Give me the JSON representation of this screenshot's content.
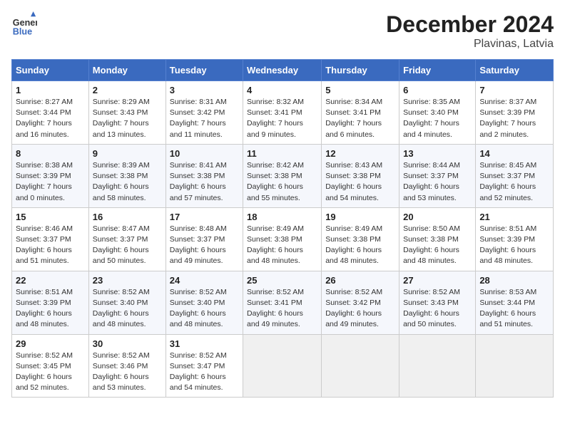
{
  "header": {
    "logo_line1": "General",
    "logo_line2": "Blue",
    "title": "December 2024",
    "subtitle": "Plavinas, Latvia"
  },
  "columns": [
    "Sunday",
    "Monday",
    "Tuesday",
    "Wednesday",
    "Thursday",
    "Friday",
    "Saturday"
  ],
  "weeks": [
    [
      {
        "day": "1",
        "sunrise": "8:27 AM",
        "sunset": "3:44 PM",
        "daylight": "7 hours and 16 minutes."
      },
      {
        "day": "2",
        "sunrise": "8:29 AM",
        "sunset": "3:43 PM",
        "daylight": "7 hours and 13 minutes."
      },
      {
        "day": "3",
        "sunrise": "8:31 AM",
        "sunset": "3:42 PM",
        "daylight": "7 hours and 11 minutes."
      },
      {
        "day": "4",
        "sunrise": "8:32 AM",
        "sunset": "3:41 PM",
        "daylight": "7 hours and 9 minutes."
      },
      {
        "day": "5",
        "sunrise": "8:34 AM",
        "sunset": "3:41 PM",
        "daylight": "7 hours and 6 minutes."
      },
      {
        "day": "6",
        "sunrise": "8:35 AM",
        "sunset": "3:40 PM",
        "daylight": "7 hours and 4 minutes."
      },
      {
        "day": "7",
        "sunrise": "8:37 AM",
        "sunset": "3:39 PM",
        "daylight": "7 hours and 2 minutes."
      }
    ],
    [
      {
        "day": "8",
        "sunrise": "8:38 AM",
        "sunset": "3:39 PM",
        "daylight": "7 hours and 0 minutes."
      },
      {
        "day": "9",
        "sunrise": "8:39 AM",
        "sunset": "3:38 PM",
        "daylight": "6 hours and 58 minutes."
      },
      {
        "day": "10",
        "sunrise": "8:41 AM",
        "sunset": "3:38 PM",
        "daylight": "6 hours and 57 minutes."
      },
      {
        "day": "11",
        "sunrise": "8:42 AM",
        "sunset": "3:38 PM",
        "daylight": "6 hours and 55 minutes."
      },
      {
        "day": "12",
        "sunrise": "8:43 AM",
        "sunset": "3:38 PM",
        "daylight": "6 hours and 54 minutes."
      },
      {
        "day": "13",
        "sunrise": "8:44 AM",
        "sunset": "3:37 PM",
        "daylight": "6 hours and 53 minutes."
      },
      {
        "day": "14",
        "sunrise": "8:45 AM",
        "sunset": "3:37 PM",
        "daylight": "6 hours and 52 minutes."
      }
    ],
    [
      {
        "day": "15",
        "sunrise": "8:46 AM",
        "sunset": "3:37 PM",
        "daylight": "6 hours and 51 minutes."
      },
      {
        "day": "16",
        "sunrise": "8:47 AM",
        "sunset": "3:37 PM",
        "daylight": "6 hours and 50 minutes."
      },
      {
        "day": "17",
        "sunrise": "8:48 AM",
        "sunset": "3:37 PM",
        "daylight": "6 hours and 49 minutes."
      },
      {
        "day": "18",
        "sunrise": "8:49 AM",
        "sunset": "3:38 PM",
        "daylight": "6 hours and 48 minutes."
      },
      {
        "day": "19",
        "sunrise": "8:49 AM",
        "sunset": "3:38 PM",
        "daylight": "6 hours and 48 minutes."
      },
      {
        "day": "20",
        "sunrise": "8:50 AM",
        "sunset": "3:38 PM",
        "daylight": "6 hours and 48 minutes."
      },
      {
        "day": "21",
        "sunrise": "8:51 AM",
        "sunset": "3:39 PM",
        "daylight": "6 hours and 48 minutes."
      }
    ],
    [
      {
        "day": "22",
        "sunrise": "8:51 AM",
        "sunset": "3:39 PM",
        "daylight": "6 hours and 48 minutes."
      },
      {
        "day": "23",
        "sunrise": "8:52 AM",
        "sunset": "3:40 PM",
        "daylight": "6 hours and 48 minutes."
      },
      {
        "day": "24",
        "sunrise": "8:52 AM",
        "sunset": "3:40 PM",
        "daylight": "6 hours and 48 minutes."
      },
      {
        "day": "25",
        "sunrise": "8:52 AM",
        "sunset": "3:41 PM",
        "daylight": "6 hours and 49 minutes."
      },
      {
        "day": "26",
        "sunrise": "8:52 AM",
        "sunset": "3:42 PM",
        "daylight": "6 hours and 49 minutes."
      },
      {
        "day": "27",
        "sunrise": "8:52 AM",
        "sunset": "3:43 PM",
        "daylight": "6 hours and 50 minutes."
      },
      {
        "day": "28",
        "sunrise": "8:53 AM",
        "sunset": "3:44 PM",
        "daylight": "6 hours and 51 minutes."
      }
    ],
    [
      {
        "day": "29",
        "sunrise": "8:52 AM",
        "sunset": "3:45 PM",
        "daylight": "6 hours and 52 minutes."
      },
      {
        "day": "30",
        "sunrise": "8:52 AM",
        "sunset": "3:46 PM",
        "daylight": "6 hours and 53 minutes."
      },
      {
        "day": "31",
        "sunrise": "8:52 AM",
        "sunset": "3:47 PM",
        "daylight": "6 hours and 54 minutes."
      },
      null,
      null,
      null,
      null
    ]
  ]
}
